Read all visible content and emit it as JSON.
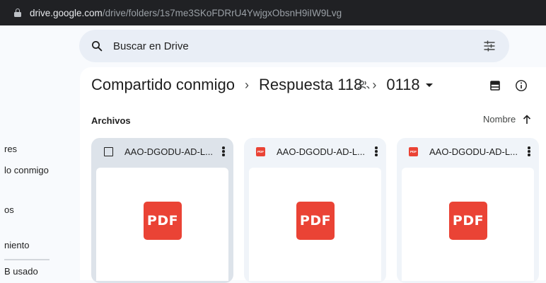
{
  "browser": {
    "url_host": "drive.google.com",
    "url_path": "/drive/folders/1s7me3SKoFDRrU4YwjgxObsnH9iIW9Lvg"
  },
  "search": {
    "placeholder": "Buscar en Drive",
    "icon": "search-icon",
    "filter_icon": "tune-icon"
  },
  "sidebar": {
    "items": [
      {
        "label": "res"
      },
      {
        "label": "lo conmigo"
      },
      {
        "label": "os"
      },
      {
        "label": "niento"
      },
      {
        "label": "B usado"
      }
    ]
  },
  "breadcrumb": {
    "items": [
      "Compartido conmigo",
      "Respuesta 118"
    ],
    "current": "0118",
    "separator": "›"
  },
  "toolbar": {
    "share_icon": "people-icon",
    "layout_icon": "list-view-icon",
    "info_icon": "info-icon"
  },
  "section": {
    "title": "Archivos",
    "sort_label": "Nombre",
    "sort_icon": "arrow-up-icon"
  },
  "files": [
    {
      "name": "AAO-DGODU-AD-L...",
      "selected": true,
      "thumb_label": "PDF"
    },
    {
      "name": "AAO-DGODU-AD-L...",
      "selected": false,
      "file_icon_label": "PDF",
      "thumb_label": "PDF"
    },
    {
      "name": "AAO-DGODU-AD-L...",
      "selected": false,
      "file_icon_label": "PDF",
      "thumb_label": "PDF"
    }
  ],
  "colors": {
    "pdf_red": "#ea4335",
    "search_bg": "#e9eef6",
    "selected_card": "#dde3ea",
    "card_bg": "#f0f4f9"
  }
}
